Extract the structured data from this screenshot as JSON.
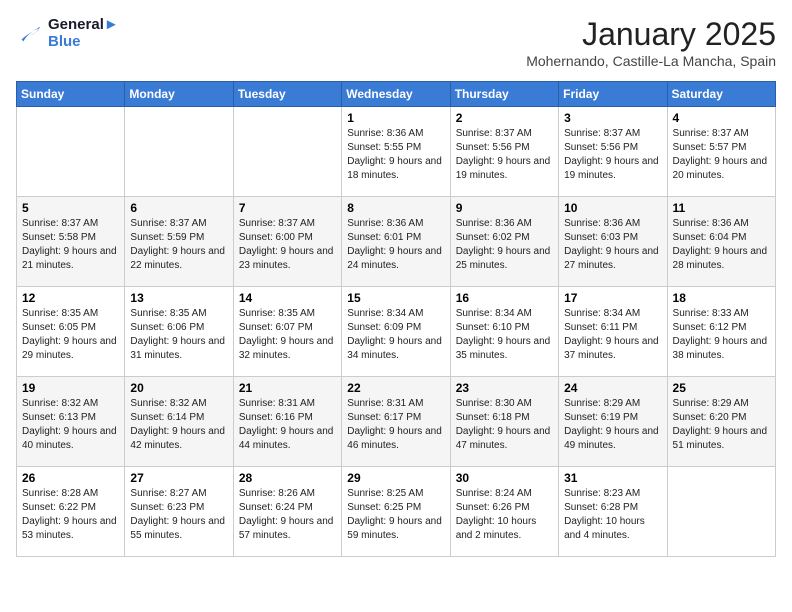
{
  "logo": {
    "line1": "General",
    "line2": "Blue"
  },
  "header": {
    "month": "January 2025",
    "location": "Mohernando, Castille-La Mancha, Spain"
  },
  "weekdays": [
    "Sunday",
    "Monday",
    "Tuesday",
    "Wednesday",
    "Thursday",
    "Friday",
    "Saturday"
  ],
  "weeks": [
    [
      {
        "day": "",
        "sunrise": "",
        "sunset": "",
        "daylight": ""
      },
      {
        "day": "",
        "sunrise": "",
        "sunset": "",
        "daylight": ""
      },
      {
        "day": "",
        "sunrise": "",
        "sunset": "",
        "daylight": ""
      },
      {
        "day": "1",
        "sunrise": "Sunrise: 8:36 AM",
        "sunset": "Sunset: 5:55 PM",
        "daylight": "Daylight: 9 hours and 18 minutes."
      },
      {
        "day": "2",
        "sunrise": "Sunrise: 8:37 AM",
        "sunset": "Sunset: 5:56 PM",
        "daylight": "Daylight: 9 hours and 19 minutes."
      },
      {
        "day": "3",
        "sunrise": "Sunrise: 8:37 AM",
        "sunset": "Sunset: 5:56 PM",
        "daylight": "Daylight: 9 hours and 19 minutes."
      },
      {
        "day": "4",
        "sunrise": "Sunrise: 8:37 AM",
        "sunset": "Sunset: 5:57 PM",
        "daylight": "Daylight: 9 hours and 20 minutes."
      }
    ],
    [
      {
        "day": "5",
        "sunrise": "Sunrise: 8:37 AM",
        "sunset": "Sunset: 5:58 PM",
        "daylight": "Daylight: 9 hours and 21 minutes."
      },
      {
        "day": "6",
        "sunrise": "Sunrise: 8:37 AM",
        "sunset": "Sunset: 5:59 PM",
        "daylight": "Daylight: 9 hours and 22 minutes."
      },
      {
        "day": "7",
        "sunrise": "Sunrise: 8:37 AM",
        "sunset": "Sunset: 6:00 PM",
        "daylight": "Daylight: 9 hours and 23 minutes."
      },
      {
        "day": "8",
        "sunrise": "Sunrise: 8:36 AM",
        "sunset": "Sunset: 6:01 PM",
        "daylight": "Daylight: 9 hours and 24 minutes."
      },
      {
        "day": "9",
        "sunrise": "Sunrise: 8:36 AM",
        "sunset": "Sunset: 6:02 PM",
        "daylight": "Daylight: 9 hours and 25 minutes."
      },
      {
        "day": "10",
        "sunrise": "Sunrise: 8:36 AM",
        "sunset": "Sunset: 6:03 PM",
        "daylight": "Daylight: 9 hours and 27 minutes."
      },
      {
        "day": "11",
        "sunrise": "Sunrise: 8:36 AM",
        "sunset": "Sunset: 6:04 PM",
        "daylight": "Daylight: 9 hours and 28 minutes."
      }
    ],
    [
      {
        "day": "12",
        "sunrise": "Sunrise: 8:35 AM",
        "sunset": "Sunset: 6:05 PM",
        "daylight": "Daylight: 9 hours and 29 minutes."
      },
      {
        "day": "13",
        "sunrise": "Sunrise: 8:35 AM",
        "sunset": "Sunset: 6:06 PM",
        "daylight": "Daylight: 9 hours and 31 minutes."
      },
      {
        "day": "14",
        "sunrise": "Sunrise: 8:35 AM",
        "sunset": "Sunset: 6:07 PM",
        "daylight": "Daylight: 9 hours and 32 minutes."
      },
      {
        "day": "15",
        "sunrise": "Sunrise: 8:34 AM",
        "sunset": "Sunset: 6:09 PM",
        "daylight": "Daylight: 9 hours and 34 minutes."
      },
      {
        "day": "16",
        "sunrise": "Sunrise: 8:34 AM",
        "sunset": "Sunset: 6:10 PM",
        "daylight": "Daylight: 9 hours and 35 minutes."
      },
      {
        "day": "17",
        "sunrise": "Sunrise: 8:34 AM",
        "sunset": "Sunset: 6:11 PM",
        "daylight": "Daylight: 9 hours and 37 minutes."
      },
      {
        "day": "18",
        "sunrise": "Sunrise: 8:33 AM",
        "sunset": "Sunset: 6:12 PM",
        "daylight": "Daylight: 9 hours and 38 minutes."
      }
    ],
    [
      {
        "day": "19",
        "sunrise": "Sunrise: 8:32 AM",
        "sunset": "Sunset: 6:13 PM",
        "daylight": "Daylight: 9 hours and 40 minutes."
      },
      {
        "day": "20",
        "sunrise": "Sunrise: 8:32 AM",
        "sunset": "Sunset: 6:14 PM",
        "daylight": "Daylight: 9 hours and 42 minutes."
      },
      {
        "day": "21",
        "sunrise": "Sunrise: 8:31 AM",
        "sunset": "Sunset: 6:16 PM",
        "daylight": "Daylight: 9 hours and 44 minutes."
      },
      {
        "day": "22",
        "sunrise": "Sunrise: 8:31 AM",
        "sunset": "Sunset: 6:17 PM",
        "daylight": "Daylight: 9 hours and 46 minutes."
      },
      {
        "day": "23",
        "sunrise": "Sunrise: 8:30 AM",
        "sunset": "Sunset: 6:18 PM",
        "daylight": "Daylight: 9 hours and 47 minutes."
      },
      {
        "day": "24",
        "sunrise": "Sunrise: 8:29 AM",
        "sunset": "Sunset: 6:19 PM",
        "daylight": "Daylight: 9 hours and 49 minutes."
      },
      {
        "day": "25",
        "sunrise": "Sunrise: 8:29 AM",
        "sunset": "Sunset: 6:20 PM",
        "daylight": "Daylight: 9 hours and 51 minutes."
      }
    ],
    [
      {
        "day": "26",
        "sunrise": "Sunrise: 8:28 AM",
        "sunset": "Sunset: 6:22 PM",
        "daylight": "Daylight: 9 hours and 53 minutes."
      },
      {
        "day": "27",
        "sunrise": "Sunrise: 8:27 AM",
        "sunset": "Sunset: 6:23 PM",
        "daylight": "Daylight: 9 hours and 55 minutes."
      },
      {
        "day": "28",
        "sunrise": "Sunrise: 8:26 AM",
        "sunset": "Sunset: 6:24 PM",
        "daylight": "Daylight: 9 hours and 57 minutes."
      },
      {
        "day": "29",
        "sunrise": "Sunrise: 8:25 AM",
        "sunset": "Sunset: 6:25 PM",
        "daylight": "Daylight: 9 hours and 59 minutes."
      },
      {
        "day": "30",
        "sunrise": "Sunrise: 8:24 AM",
        "sunset": "Sunset: 6:26 PM",
        "daylight": "Daylight: 10 hours and 2 minutes."
      },
      {
        "day": "31",
        "sunrise": "Sunrise: 8:23 AM",
        "sunset": "Sunset: 6:28 PM",
        "daylight": "Daylight: 10 hours and 4 minutes."
      },
      {
        "day": "",
        "sunrise": "",
        "sunset": "",
        "daylight": ""
      }
    ]
  ]
}
